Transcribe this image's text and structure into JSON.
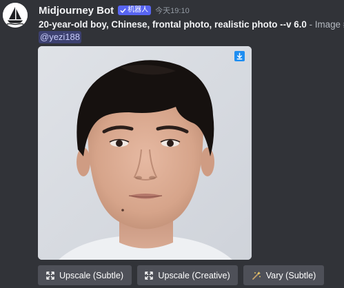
{
  "message": {
    "author": {
      "name": "Midjourney Bot",
      "badge": "机器人",
      "avatar": "midjourney-sailboat-logo"
    },
    "timestamp": "今天19:10",
    "prompt": "20-year-old boy, Chinese, frontal photo, realistic photo --v 6.0",
    "prompt_suffix": " - Image #",
    "mention": "@yezi188",
    "image": {
      "description": "generated portrait",
      "download_icon": "download-icon"
    },
    "actions": [
      {
        "label": "Upscale (Subtle)",
        "icon": "upscale-icon"
      },
      {
        "label": "Upscale (Creative)",
        "icon": "upscale-icon"
      },
      {
        "label": "Vary (Subtle)",
        "icon": "sparkle-wand-icon"
      }
    ]
  },
  "colors": {
    "background": "#313338",
    "bot_badge": "#5865f2",
    "button": "#4e5058",
    "mention_text": "#c9cdfb",
    "timestamp": "#949ba4"
  }
}
